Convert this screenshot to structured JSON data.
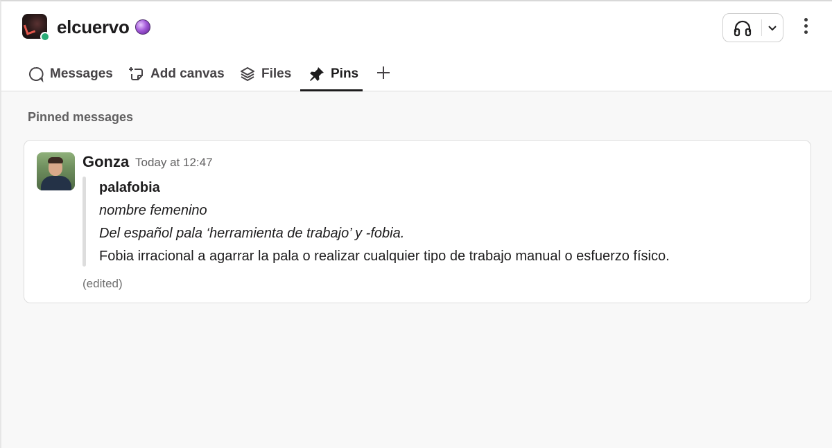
{
  "channel": {
    "name": "elcuervo",
    "emoji": "crystal-ball",
    "presence": "active"
  },
  "header": {
    "huddle_icon": "headphones-icon",
    "menu_icon": "more-vertical-icon"
  },
  "tabs": [
    {
      "label": "Messages",
      "icon": "message-bubble-icon",
      "active": false
    },
    {
      "label": "Add canvas",
      "icon": "canvas-add-icon",
      "active": false
    },
    {
      "label": "Files",
      "icon": "files-layers-icon",
      "active": false
    },
    {
      "label": "Pins",
      "icon": "pin-icon",
      "active": true
    }
  ],
  "section": {
    "title": "Pinned messages"
  },
  "pinned_message": {
    "author": "Gonza",
    "timestamp": "Today at 12:47",
    "lines": [
      "palafobia",
      "nombre femenino",
      "Del español pala ‘herramienta de trabajo’ y -fobia.",
      "Fobia irracional a agarrar la pala o realizar cualquier tipo de trabajo manual o esfuerzo físico."
    ],
    "edited_label": "(edited)"
  },
  "colors": {
    "presence_green": "#2bac76",
    "text_primary": "#1d1c1d",
    "text_secondary": "#616061",
    "quote_bar": "#dddddd",
    "background": "#f8f8f8"
  }
}
